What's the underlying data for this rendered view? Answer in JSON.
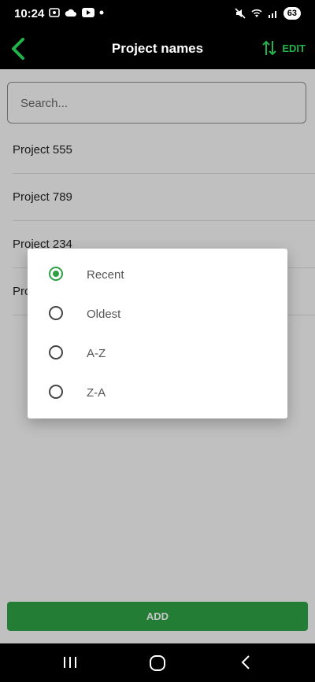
{
  "status": {
    "time": "10:24",
    "battery": "63"
  },
  "header": {
    "title": "Project names",
    "edit_label": "EDIT"
  },
  "search": {
    "placeholder": "Search..."
  },
  "projects": [
    {
      "name": "Project 555"
    },
    {
      "name": "Project 789"
    },
    {
      "name": "Project 234"
    },
    {
      "name": "Pro"
    }
  ],
  "sort_dialog": {
    "options": [
      {
        "label": "Recent",
        "selected": true
      },
      {
        "label": "Oldest",
        "selected": false
      },
      {
        "label": "A-Z",
        "selected": false
      },
      {
        "label": "Z-A",
        "selected": false
      }
    ]
  },
  "add_button": {
    "label": "ADD"
  },
  "colors": {
    "accent": "#2ea043",
    "header_bg": "#000000"
  },
  "icons": [
    "back-arrow-icon",
    "sort-icon",
    "recents-icon",
    "home-icon",
    "back-icon"
  ]
}
